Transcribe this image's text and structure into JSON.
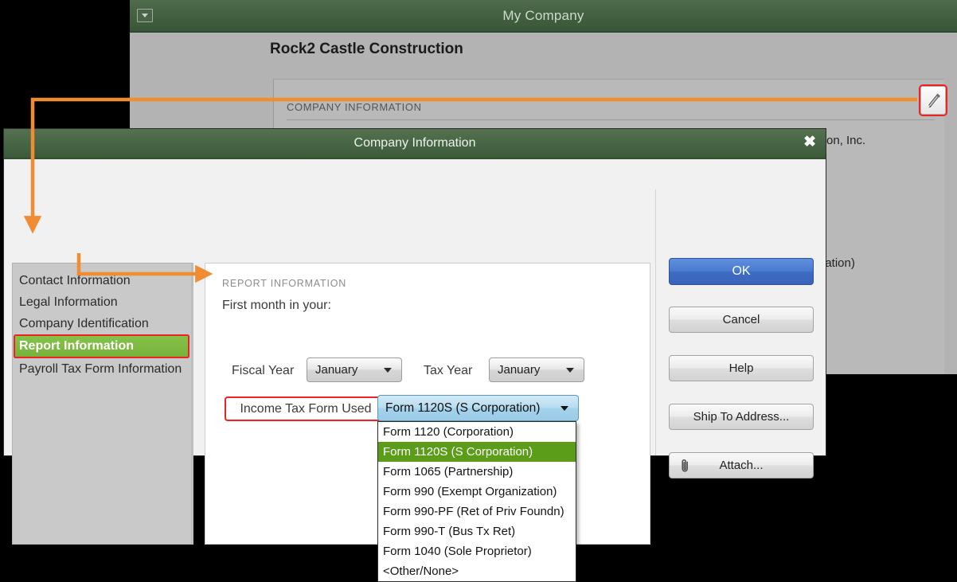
{
  "background_window": {
    "title": "My Company",
    "window_icon": "window-dropdown-icon",
    "company_name": "Rock2 Castle Construction",
    "section_label": "COMPANY INFORMATION",
    "detail_line_1": "ction, Inc.",
    "detail_line_2": "oration)",
    "attach_icon": "paperclip-icon"
  },
  "dialog": {
    "title": "Company Information",
    "close_label": "✖",
    "sidebar": {
      "items": [
        {
          "label": "Contact Information",
          "selected": false
        },
        {
          "label": "Legal Information",
          "selected": false
        },
        {
          "label": "Company Identification",
          "selected": false
        },
        {
          "label": "Report Information",
          "selected": true
        },
        {
          "label": "Payroll Tax Form Information",
          "selected": false
        }
      ]
    },
    "content": {
      "section_header": "REPORT INFORMATION",
      "first_month_label": "First month in your:",
      "fiscal_year": {
        "label": "Fiscal Year",
        "value": "January"
      },
      "tax_year": {
        "label": "Tax Year",
        "value": "January"
      },
      "income_tax_form": {
        "label": "Income Tax Form Used",
        "value": "Form 1120S (S Corporation)",
        "options": [
          "Form 1120 (Corporation)",
          "Form 1120S (S Corporation)",
          "Form 1065 (Partnership)",
          "Form 990 (Exempt Organization)",
          "Form 990-PF (Ret of Priv Foundn)",
          "Form 990-T (Bus Tx Ret)",
          "Form 1040 (Sole Proprietor)",
          "<Other/None>"
        ],
        "highlighted_option": "Form 1120S (S Corporation)"
      }
    },
    "buttons": {
      "ok": "OK",
      "cancel": "Cancel",
      "help": "Help",
      "ship_to_address": "Ship To Address...",
      "attach": "Attach...",
      "attach_icon": "paperclip-icon"
    }
  },
  "annotations": {
    "accent_color": "#f28c32",
    "highlight_outline_color": "#ee2222",
    "selection_green": "#77b23b",
    "dropdown_highlight_green": "#5b9c18",
    "primary_button_blue": "#4a7bd0",
    "titlebar_green": "#41603e"
  }
}
